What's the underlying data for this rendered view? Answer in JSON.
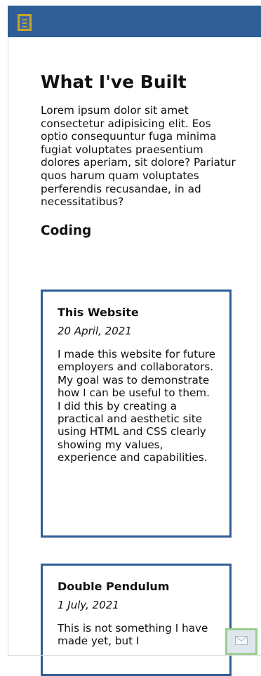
{
  "header": {
    "menu_icon": "hamburger-menu-icon",
    "brand_color": "#2e5e95",
    "accent_color": "#c9a42b"
  },
  "main": {
    "title": "What I've Built",
    "intro": "Lorem ipsum dolor sit amet consectetur adipisicing elit. Eos optio consequuntur fuga minima fugiat voluptates praesentium dolores aperiam, sit dolore? Pariatur quos harum quam voluptates perferendis recusandae, in ad necessitatibus?",
    "section_title": "Coding",
    "projects": [
      {
        "title": "This Website",
        "date": "20 April, 2021",
        "description": "I made this website for future employers and collaborators. My goal was to demonstrate how I can be useful to them. I did this by creating a practical and aesthetic site using HTML and CSS clearly showing my values, experience and capabilities."
      },
      {
        "title": "Double Pendulum",
        "date": "1 July, 2021",
        "description": "This is not something I have made yet, but I"
      }
    ]
  },
  "contact": {
    "icon": "envelope-icon"
  }
}
